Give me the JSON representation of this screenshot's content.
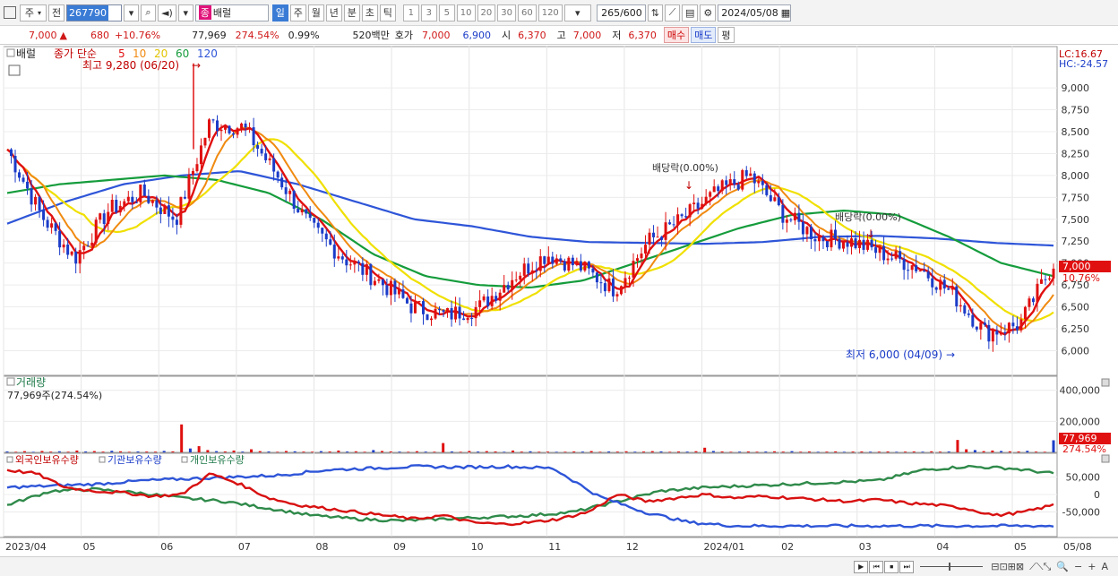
{
  "toolbar": {
    "market_label": "주",
    "market_dd": "▾",
    "period_label": "전",
    "stock_code": "267790",
    "stock_badge": "종",
    "stock_name": "배럴",
    "tabs": [
      "일",
      "주",
      "월",
      "년",
      "분",
      "초",
      "틱"
    ],
    "active_tab": "일",
    "num_buttons": [
      "1",
      "3",
      "5",
      "10",
      "20",
      "30",
      "60",
      "120"
    ],
    "bar_count": "265",
    "bar_max": "/600",
    "date": "2024/05/08"
  },
  "quote": {
    "price": "7,000",
    "arrow": "▲",
    "change": "680",
    "change_pct": "+10.76%",
    "volume": "77,969",
    "volume_pct": "274.54%",
    "turnover": "0.99%",
    "amount": "520백만",
    "hoga_label": "호가",
    "hoga_ask": "7,000",
    "hoga_bid": "6,900",
    "open_label": "시",
    "open": "6,370",
    "high_label": "고",
    "high": "7,000",
    "low_label": "저",
    "low": "6,370",
    "buy_label": "매수",
    "sell_label": "매도",
    "avg_label": "평"
  },
  "chart_data": [
    {
      "type": "line",
      "title": "배럴",
      "subtitle": "종가 단순",
      "ma_periods": [
        "5",
        "10",
        "20",
        "60",
        "120"
      ],
      "ma_colors": [
        "#e01010",
        "#f08a10",
        "#f0e000",
        "#159c3c",
        "#2e55d8"
      ],
      "x": [
        "2023-04-03",
        "2023-05-01",
        "2023-06-01",
        "2023-07-01",
        "2023-08-01",
        "2023-09-01",
        "2023-10-01",
        "2023-11-01",
        "2023-12-01",
        "2024-01-01",
        "2024-02-01",
        "2024-03-01",
        "2024-04-01",
        "2024-05-01",
        "2024-05-08"
      ],
      "x_tick_labels": [
        "2023/04",
        "05",
        "06",
        "07",
        "08",
        "09",
        "10",
        "11",
        "12",
        "2024/01",
        "02",
        "03",
        "04",
        "05",
        "05/08"
      ],
      "y_ticks": [
        "9,000",
        "8,750",
        "8,500",
        "8,250",
        "8,000",
        "7,750",
        "7,500",
        "7,250",
        "7,000",
        "6,750",
        "6,500",
        "6,250",
        "6,000"
      ],
      "ylim": [
        5800,
        9400
      ],
      "close": [
        8300,
        7550,
        7050,
        7600,
        7800,
        7500,
        8600,
        8550,
        8000,
        7400,
        7050,
        6800,
        6500,
        6400,
        6500,
        6850,
        7100,
        6950,
        6700,
        7250,
        7500,
        7800,
        8000,
        7550,
        7300,
        7250,
        7100,
        6950,
        6650,
        6200,
        6300,
        7000
      ],
      "ma120": [
        7450,
        7700,
        7900,
        8000,
        8050,
        7900,
        7700,
        7500,
        7420,
        7300,
        7240,
        7230,
        7220,
        7240,
        7300,
        7310,
        7280,
        7230,
        7200
      ],
      "ma60": [
        7800,
        7900,
        7950,
        8000,
        7950,
        7800,
        7500,
        7100,
        6850,
        6750,
        6720,
        6800,
        7000,
        7200,
        7400,
        7550,
        7600,
        7550,
        7300,
        7000,
        6850
      ],
      "hi_label": "최고 9,280 (06/20)",
      "hi_value": 9280,
      "lo_label": "최저 6,000 (04/09)",
      "lo_value": 6000,
      "div1": "배당락(0.00%)",
      "div2": "배당락(0.00%)",
      "lc": "LC:16.67",
      "hc": "HC:-24.57",
      "last_price": "7,000",
      "last_pct": "10.76%"
    },
    {
      "type": "bar",
      "title": "거래량",
      "subtitle": "77,969주(274.54%)",
      "y_ticks": [
        "400,000",
        "200,000"
      ],
      "ylim": [
        0,
        450000
      ],
      "values": [
        6000,
        4000,
        8000,
        3500,
        9000,
        5000,
        7000,
        4500,
        12000,
        6000,
        8500,
        5000,
        10000,
        7000,
        4000,
        6000,
        5500,
        4800,
        9500,
        6500,
        180000,
        25000,
        40000,
        15000,
        8000,
        6000,
        12000,
        5000,
        20000,
        8000,
        6000,
        4000,
        9000,
        7000,
        5000,
        4500,
        8000,
        6000,
        12000,
        5500,
        7000,
        4000,
        15000,
        9000,
        6000,
        5000,
        4000,
        7500,
        5000,
        4500,
        60000,
        6000,
        4000,
        9000,
        5500,
        8000,
        6000,
        4000,
        12000,
        5000,
        7000,
        4500,
        5000,
        3800,
        4200,
        6000,
        5000,
        8500,
        4000,
        6000,
        5000,
        7000,
        4500,
        5500,
        8000,
        6500,
        4000,
        6000,
        5000,
        7500,
        30000,
        9000,
        6000,
        4000,
        5000,
        6000,
        4500,
        5500,
        7000,
        5000,
        8000,
        4500,
        6000,
        4000,
        5000,
        6500,
        4000,
        5500,
        6000,
        4500,
        5000,
        6000,
        4000,
        5000,
        6000,
        4500,
        7000,
        5000,
        6000,
        80000,
        20000,
        15000,
        8000,
        12000,
        9000,
        7000,
        6000,
        10000,
        5000,
        4000,
        77969
      ],
      "vol_label": "77,969",
      "vol_pct": "274.54%"
    },
    {
      "type": "line",
      "title": "외국인보유수량",
      "series_names": [
        "외국인보유수량",
        "기관보유수량",
        "개인보유수량"
      ],
      "series_colors": [
        "#d81010",
        "#2e55d8",
        "#2f8a4a"
      ],
      "y_ticks": [
        "50,000",
        "0",
        "-50,000"
      ],
      "ylim": [
        -100000,
        100000
      ],
      "foreign": [
        70000,
        60000,
        20000,
        10000,
        5000,
        -5000,
        0,
        60000,
        30000,
        -10000,
        -30000,
        -40000,
        -50000,
        -60000,
        -70000,
        -60000,
        -80000,
        -85000,
        -80000,
        -70000,
        -50000,
        0,
        -20000,
        -10000,
        0,
        -10000,
        -5000,
        -10000,
        -15000,
        -20000,
        -15000,
        -25000,
        -30000,
        -40000,
        -60000,
        -50000,
        -30000
      ],
      "inst": [
        20000,
        25000,
        30000,
        40000,
        45000,
        50000,
        55000,
        70000,
        75000,
        80000,
        78000,
        80000,
        75000,
        -5000,
        -50000,
        -80000,
        -90000,
        -90000,
        -90000,
        -90000,
        -90000,
        -90000,
        -90000,
        -90000
      ],
      "indiv": [
        -30000,
        10000,
        15000,
        5000,
        -10000,
        -20000,
        -40000,
        -60000,
        -70000,
        -75000,
        -70000,
        -65000,
        -60000,
        -50000,
        -20000,
        10000,
        20000,
        25000,
        30000,
        35000,
        40000,
        70000,
        80000,
        75000,
        60000
      ]
    }
  ],
  "bottom": {
    "nav": [
      "▶",
      "⏮",
      "⏹",
      "⏭"
    ],
    "right_icons": [
      "🔍",
      "−",
      "+",
      "A"
    ]
  }
}
